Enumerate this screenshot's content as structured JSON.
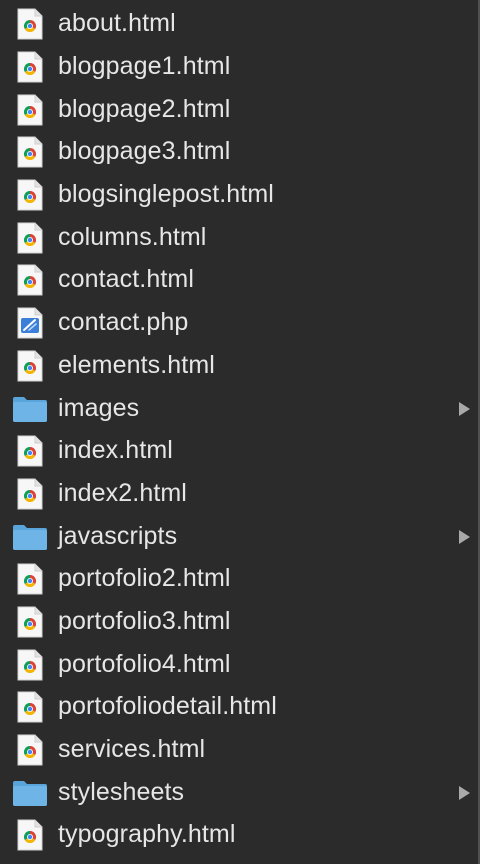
{
  "files": [
    {
      "name": "about.html",
      "icon": "html-chrome-icon",
      "is_folder": false
    },
    {
      "name": "blogpage1.html",
      "icon": "html-chrome-icon",
      "is_folder": false
    },
    {
      "name": "blogpage2.html",
      "icon": "html-chrome-icon",
      "is_folder": false
    },
    {
      "name": "blogpage3.html",
      "icon": "html-chrome-icon",
      "is_folder": false
    },
    {
      "name": "blogsinglepost.html",
      "icon": "html-chrome-icon",
      "is_folder": false
    },
    {
      "name": "columns.html",
      "icon": "html-chrome-icon",
      "is_folder": false
    },
    {
      "name": "contact.html",
      "icon": "html-chrome-icon",
      "is_folder": false
    },
    {
      "name": "contact.php",
      "icon": "php-script-icon",
      "is_folder": false
    },
    {
      "name": "elements.html",
      "icon": "html-chrome-icon",
      "is_folder": false
    },
    {
      "name": "images",
      "icon": "folder-icon",
      "is_folder": true
    },
    {
      "name": "index.html",
      "icon": "html-chrome-icon",
      "is_folder": false
    },
    {
      "name": "index2.html",
      "icon": "html-chrome-icon",
      "is_folder": false
    },
    {
      "name": "javascripts",
      "icon": "folder-icon",
      "is_folder": true
    },
    {
      "name": "portofolio2.html",
      "icon": "html-chrome-icon",
      "is_folder": false
    },
    {
      "name": "portofolio3.html",
      "icon": "html-chrome-icon",
      "is_folder": false
    },
    {
      "name": "portofolio4.html",
      "icon": "html-chrome-icon",
      "is_folder": false
    },
    {
      "name": "portofoliodetail.html",
      "icon": "html-chrome-icon",
      "is_folder": false
    },
    {
      "name": "services.html",
      "icon": "html-chrome-icon",
      "is_folder": false
    },
    {
      "name": "stylesheets",
      "icon": "folder-icon",
      "is_folder": true
    },
    {
      "name": "typography.html",
      "icon": "html-chrome-icon",
      "is_folder": false
    }
  ],
  "colors": {
    "background": "#2b2b2c",
    "text": "#e6e6e6",
    "folder": "#6fb4e6",
    "chevron": "#a9a9aa"
  }
}
